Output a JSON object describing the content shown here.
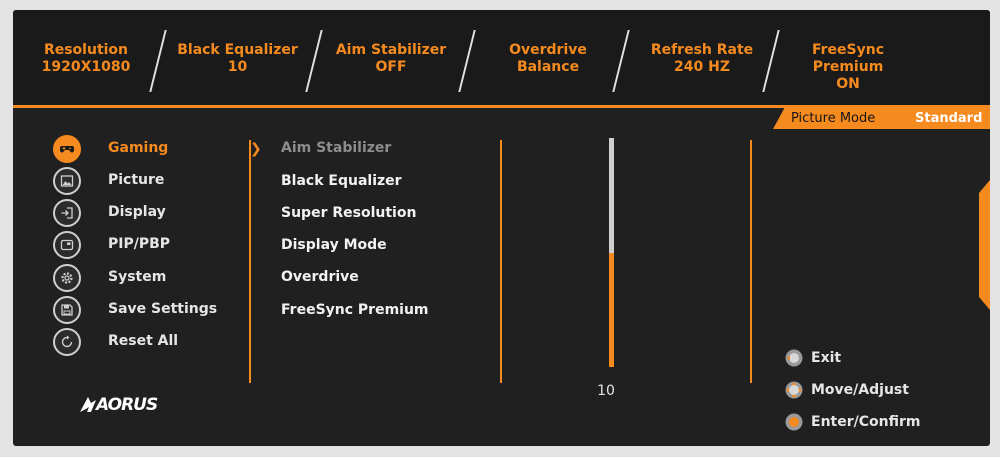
{
  "status_bar": [
    {
      "label": "Resolution",
      "value": "1920X1080"
    },
    {
      "label": "Black Equalizer",
      "value": "10"
    },
    {
      "label": "Aim Stabilizer",
      "value": "OFF"
    },
    {
      "label": "Overdrive",
      "value": "Balance"
    },
    {
      "label": "Refresh Rate",
      "value": "240 HZ"
    },
    {
      "label": "FreeSync Premium",
      "value": "ON"
    }
  ],
  "picture_mode": {
    "label": "Picture Mode",
    "value": "Standard"
  },
  "main_menu": [
    {
      "label": "Gaming",
      "icon": "gamepad-icon",
      "active": true
    },
    {
      "label": "Picture",
      "icon": "picture-icon",
      "active": false
    },
    {
      "label": "Display",
      "icon": "display-input-icon",
      "active": false
    },
    {
      "label": "PIP/PBP",
      "icon": "pip-icon",
      "active": false
    },
    {
      "label": "System",
      "icon": "gear-icon",
      "active": false
    },
    {
      "label": "Save Settings",
      "icon": "save-icon",
      "active": false
    },
    {
      "label": "Reset All",
      "icon": "reset-icon",
      "active": false
    }
  ],
  "submenu": [
    {
      "label": "Aim Stabilizer",
      "dimmed": true
    },
    {
      "label": "Black Equalizer",
      "dimmed": false
    },
    {
      "label": "Super Resolution",
      "dimmed": false
    },
    {
      "label": "Display Mode",
      "dimmed": false
    },
    {
      "label": "Overdrive",
      "dimmed": false
    },
    {
      "label": "FreeSync Premium",
      "dimmed": false
    }
  ],
  "slider": {
    "value": "10",
    "fraction": 0.5
  },
  "hints": [
    {
      "label": "Exit",
      "icon": "joystick-exit-icon"
    },
    {
      "label": "Move/Adjust",
      "icon": "joystick-move-icon"
    },
    {
      "label": "Enter/Confirm",
      "icon": "joystick-enter-icon"
    }
  ],
  "logo": {
    "text": "AORUS"
  },
  "colors": {
    "accent": "#f58a1f",
    "panel": "#202020",
    "text": "#e6e6e6",
    "dim_text": "#8d8d8d"
  }
}
